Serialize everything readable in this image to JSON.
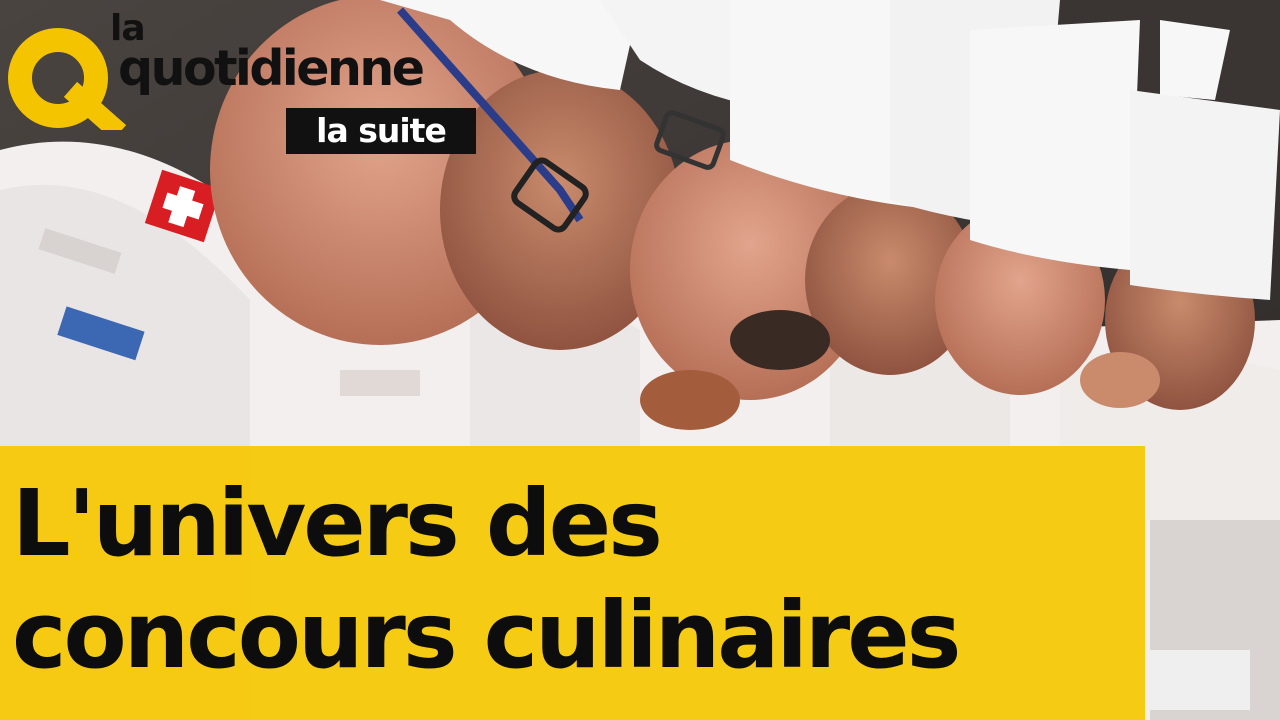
{
  "logo": {
    "line1": "la",
    "line2": "quotidienne",
    "tag": "la suite",
    "accent": "#f5c400"
  },
  "headline": {
    "line1": "L'univers des",
    "line2": "concours culinaires"
  },
  "colors": {
    "banner": "#f6c802",
    "text": "#0d0d0d"
  },
  "image": {
    "subject": "chef-jury-photo"
  }
}
